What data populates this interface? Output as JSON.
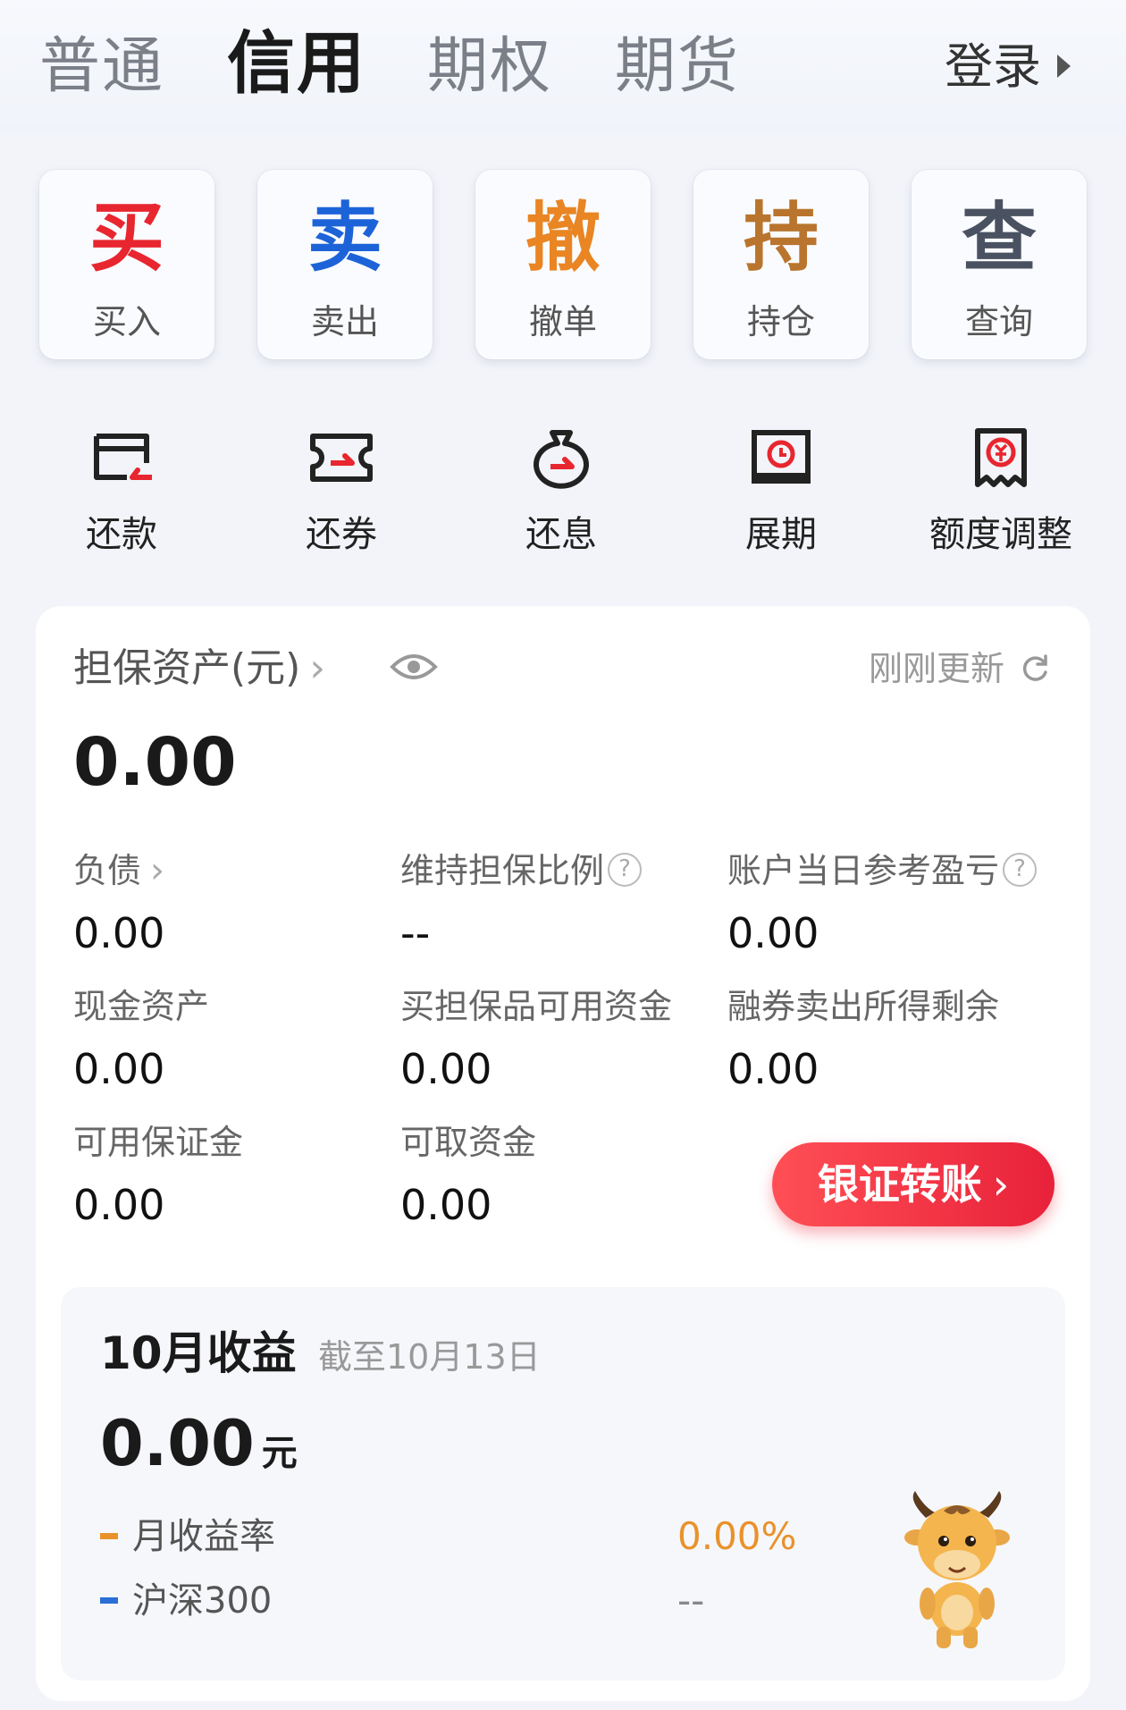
{
  "tabs": [
    "普通",
    "信用",
    "期权",
    "期货"
  ],
  "login_label": "登录",
  "actions": [
    {
      "char": "买",
      "label": "买入",
      "color": "#e8262f"
    },
    {
      "char": "卖",
      "label": "卖出",
      "color": "#1d63d8"
    },
    {
      "char": "撤",
      "label": "撤单",
      "color": "#e98523"
    },
    {
      "char": "持",
      "label": "持仓",
      "color": "#b9752e"
    },
    {
      "char": "查",
      "label": "查询",
      "color": "#4a5262"
    }
  ],
  "tools": [
    {
      "label": "还款",
      "icon": "card-repay-icon"
    },
    {
      "label": "还券",
      "icon": "ticket-repay-icon"
    },
    {
      "label": "还息",
      "icon": "moneybag-icon"
    },
    {
      "label": "展期",
      "icon": "calendar-clock-icon"
    },
    {
      "label": "额度调整",
      "icon": "quota-icon"
    }
  ],
  "assets": {
    "title": "担保资产(元)",
    "refresh_text": "刚刚更新",
    "total": "0.00",
    "metrics": [
      {
        "label": "负债",
        "value": "0.00"
      },
      {
        "label": "维持担保比例",
        "value": "--"
      },
      {
        "label": "账户当日参考盈亏",
        "value": "0.00"
      },
      {
        "label": "现金资产",
        "value": "0.00"
      },
      {
        "label": "买担保品可用资金",
        "value": "0.00"
      },
      {
        "label": "融券卖出所得剩余",
        "value": "0.00"
      },
      {
        "label": "可用保证金",
        "value": "0.00"
      },
      {
        "label": "可取资金",
        "value": "0.00"
      }
    ],
    "transfer_button": "银证转账"
  },
  "earnings": {
    "title": "10月收益",
    "as_of": "截至10月13日",
    "amount": "0.00",
    "unit": "元",
    "legend": [
      {
        "label": "月收益率",
        "value": "0.00%",
        "color": "#e9922b"
      },
      {
        "label": "沪深300",
        "value": "--",
        "color": "#2b6fd6"
      }
    ]
  }
}
